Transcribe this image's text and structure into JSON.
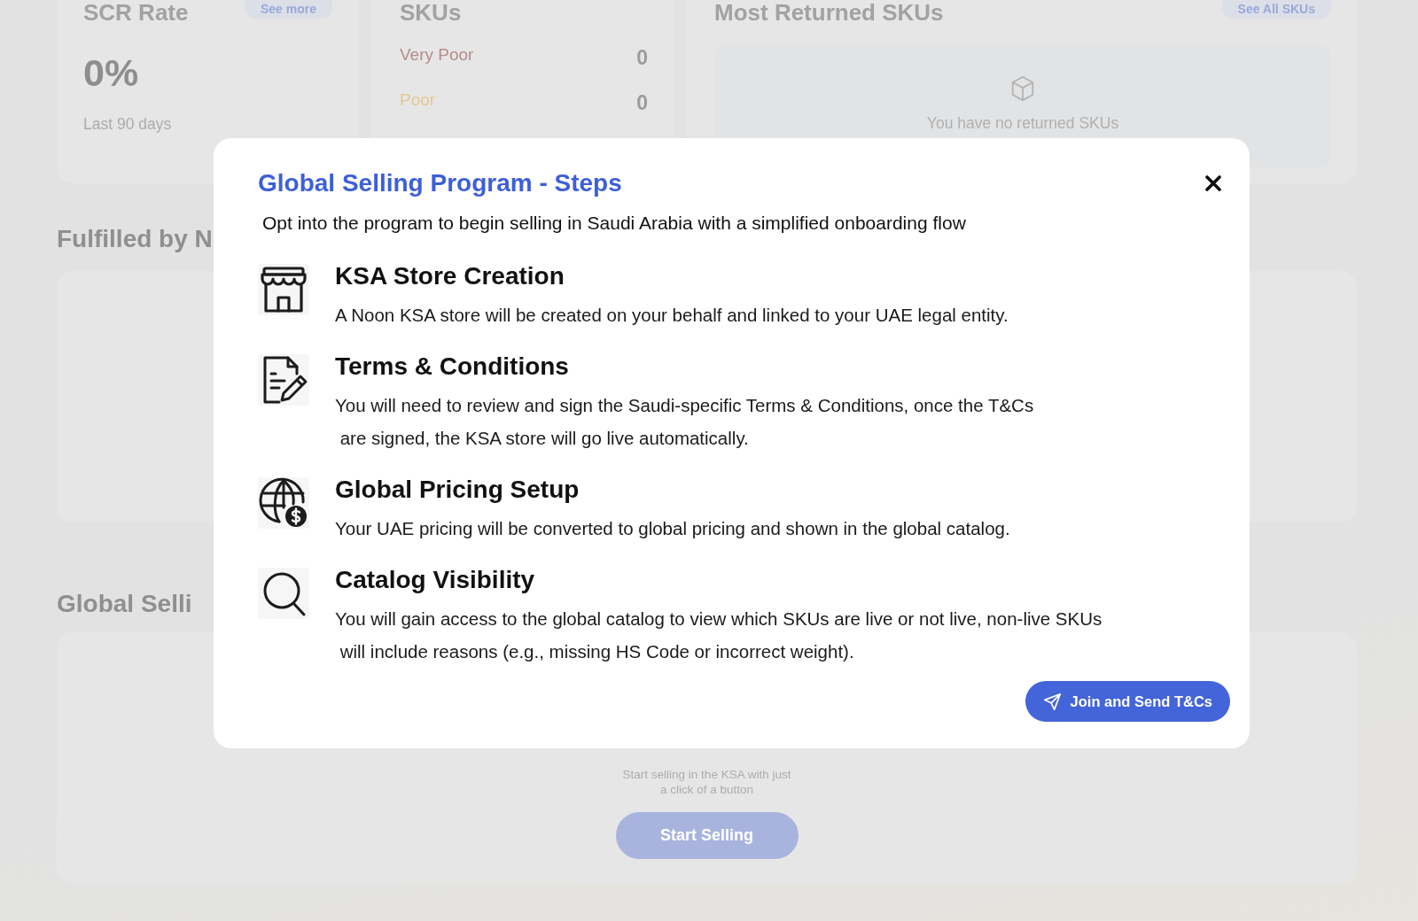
{
  "dashboard": {
    "scr_card": {
      "title": "SCR Rate",
      "link": "See more",
      "value": "0%",
      "caption": "Last 90 days"
    },
    "skus_card": {
      "title": "SKUs",
      "rows": [
        {
          "label": "Very Poor",
          "count": "0",
          "color": "#b58c8c"
        },
        {
          "label": "Poor",
          "count": "0",
          "color": "#e2c98f"
        }
      ]
    },
    "returned_card": {
      "title": "Most Returned SKUs",
      "link": "See All SKUs",
      "empty_message": "You have no returned SKUs"
    },
    "fulfilled_section": {
      "heading": "Fulfilled by N"
    },
    "global_selling_section": {
      "heading": "Global Selli",
      "message": "Start selling in the KSA with just a click of a button",
      "button": "Start Selling"
    }
  },
  "dialog": {
    "title": "Global Selling Program - Steps",
    "subtitle": "Opt into the program to begin selling in Saudi Arabia with a simplified onboarding flow",
    "steps": [
      {
        "kind": "store",
        "title": "KSA Store Creation",
        "description": "A Noon KSA store will be created on your behalf and linked to your UAE legal entity."
      },
      {
        "kind": "document",
        "title": "Terms & Conditions",
        "description": "You will need to review and sign the Saudi-specific Terms & Conditions, once the T&Cs\n are signed, the KSA store will go live automatically."
      },
      {
        "kind": "globe",
        "title": "Global Pricing Setup",
        "description": "Your UAE pricing will be converted to global pricing and shown in the global catalog."
      },
      {
        "kind": "search",
        "title": "Catalog Visibility",
        "description": "You will gain access to the global catalog to view which SKUs are live or not live, non-live SKUs\n will include reasons (e.g., missing HS Code or incorrect weight)."
      }
    ],
    "button": "Join and Send T&Cs"
  }
}
